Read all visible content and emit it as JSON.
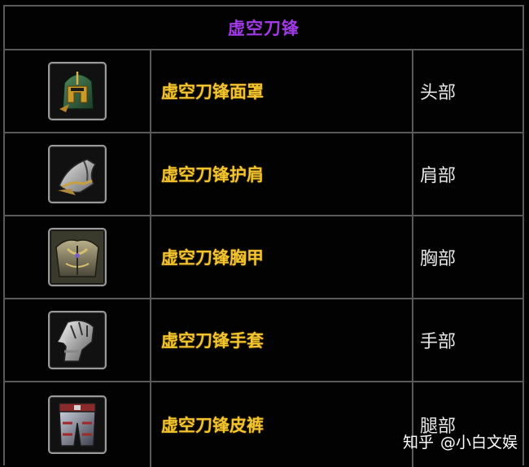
{
  "table": {
    "title": "虚空刀锋",
    "rows": [
      {
        "icon": "helmet-icon",
        "name": "虚空刀锋面罩",
        "slot": "头部"
      },
      {
        "icon": "shoulder-armor-icon",
        "name": "虚空刀锋护肩",
        "slot": "肩部"
      },
      {
        "icon": "chest-armor-icon",
        "name": "虚空刀锋胸甲",
        "slot": "胸部"
      },
      {
        "icon": "gauntlet-icon",
        "name": "虚空刀锋手套",
        "slot": "手部"
      },
      {
        "icon": "leg-armor-icon",
        "name": "虚空刀锋皮裤",
        "slot": "腿部"
      }
    ]
  },
  "watermark": {
    "platform": "知乎",
    "author": "@小白文娱"
  },
  "colors": {
    "title": "#a23ae8",
    "item_name": "#f2c530",
    "slot_text": "#e6e6e6",
    "grid_line": "#5a5a5a"
  }
}
